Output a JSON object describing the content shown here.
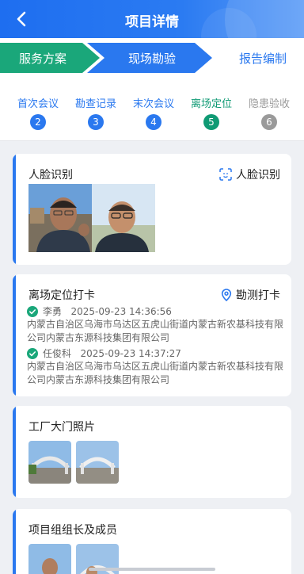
{
  "header": {
    "title": "项目详情"
  },
  "steps": [
    {
      "label": "服务方案",
      "state": "done"
    },
    {
      "label": "现场勘验",
      "state": "active"
    },
    {
      "label": "报告编制",
      "state": "pending"
    }
  ],
  "subtabs": [
    {
      "label": "首次会议",
      "num": "2",
      "state": "done"
    },
    {
      "label": "勘查记录",
      "num": "3",
      "state": "done"
    },
    {
      "label": "末次会议",
      "num": "4",
      "state": "done"
    },
    {
      "label": "离场定位",
      "num": "5",
      "state": "active"
    },
    {
      "label": "隐患验收",
      "num": "6",
      "state": "pending"
    }
  ],
  "cards": {
    "face": {
      "title": "人脸识别",
      "action": "人脸识别"
    },
    "location": {
      "title": "离场定位打卡",
      "action": "勘测打卡",
      "records": [
        {
          "name": "李勇",
          "time": "2025-09-23 14:36:56",
          "address": "内蒙古自治区乌海市乌达区五虎山街道内蒙古新农基科技有限公司内蒙古东源科技集团有限公司"
        },
        {
          "name": "任俊科",
          "time": "2025-09-23 14:37:27",
          "address": "内蒙古自治区乌海市乌达区五虎山街道内蒙古新农基科技有限公司内蒙古东源科技集团有限公司"
        }
      ]
    },
    "gate": {
      "title": "工厂大门照片"
    },
    "team": {
      "title": "项目组组长及成员"
    }
  },
  "colors": {
    "primary": "#2a78ef",
    "done": "#1aa77a",
    "active_tab": "#0f9a74",
    "pending": "#9a9a9a"
  },
  "icons": {
    "back": "chevron-left-icon",
    "face_scan": "face-scan-icon",
    "location": "location-pin-icon",
    "check": "check-circle-icon"
  }
}
